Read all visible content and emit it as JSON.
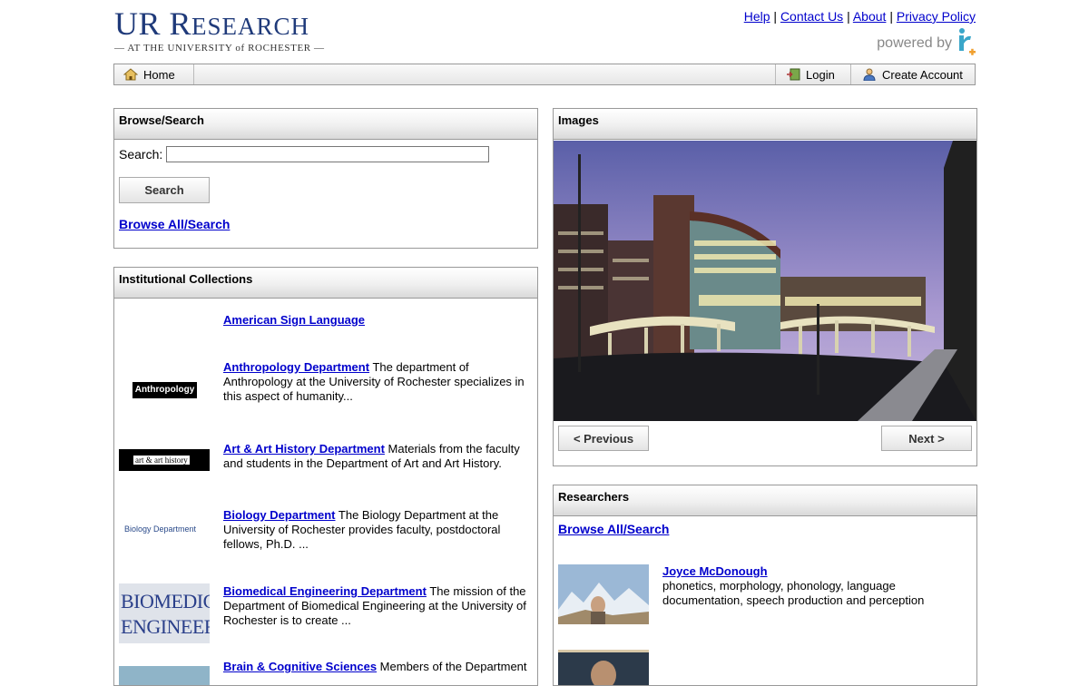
{
  "header": {
    "logo_main_a": "UR R",
    "logo_main_b": "ESEARCH",
    "logo_sub": "— AT THE UNIVERSITY of ROCHESTER —",
    "powered_by": "powered by",
    "top_links": [
      "Help",
      "Contact Us",
      "About",
      "Privacy Policy"
    ]
  },
  "nav": {
    "home": "Home",
    "login": "Login",
    "create_account": "Create Account"
  },
  "browse": {
    "title": "Browse/Search",
    "search_label": "Search:",
    "search_value": "",
    "search_button": "Search",
    "browse_all": "Browse All/Search"
  },
  "collections": {
    "title": "Institutional Collections",
    "items": [
      {
        "name": "American Sign Language",
        "desc": "",
        "thumb": ""
      },
      {
        "name": "Anthropology Department",
        "desc": " The department of Anthropology at the University of Rochester specializes in this aspect of humanity...",
        "thumb": "Anthropology"
      },
      {
        "name": "Art & Art History Department",
        "desc": " Materials from the faculty and students in the Department of Art and Art History.",
        "thumb": "art & art history"
      },
      {
        "name": "Biology Department",
        "desc": " The Biology Department at the University of Rochester provides faculty, postdoctoral fellows, Ph.D. ...",
        "thumb": "Biology Department"
      },
      {
        "name": "Biomedical Engineering Department",
        "desc": " The mission of the Department of Biomedical Engineering at the University of Rochester is to create ...",
        "thumb": "BIOMEDICAL ENGINEERING"
      },
      {
        "name": "Brain & Cognitive Sciences",
        "desc": " Members of the Department",
        "thumb": ""
      }
    ]
  },
  "images": {
    "title": "Images",
    "previous": "< Previous",
    "next": "Next >"
  },
  "researchers": {
    "title": "Researchers",
    "browse_all": "Browse All/Search",
    "items": [
      {
        "name": "Joyce McDonough",
        "desc": "phonetics, morphology, phonology, language documentation, speech production and perception"
      }
    ]
  },
  "colors": {
    "link": "#0000cc",
    "logo_blue": "#1f3a7a",
    "panel_border": "#999999"
  }
}
